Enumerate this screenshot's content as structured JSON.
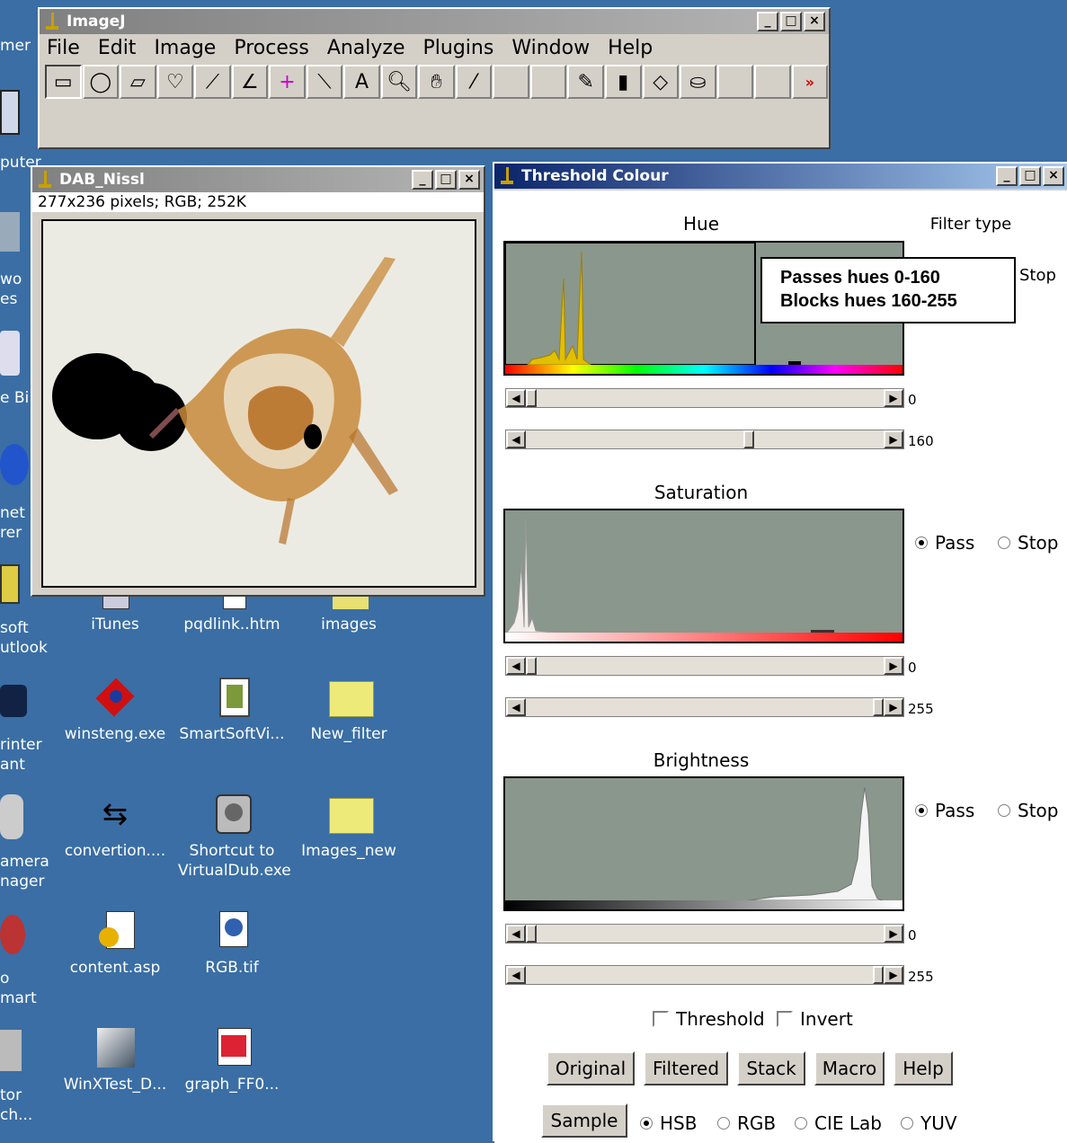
{
  "imagej": {
    "title": "ImageJ",
    "menus": [
      "File",
      "Edit",
      "Image",
      "Process",
      "Analyze",
      "Plugins",
      "Window",
      "Help"
    ],
    "tools": [
      "rectangle-tool-icon",
      "oval-tool-icon",
      "polygon-tool-icon",
      "freehand-tool-icon",
      "line-tool-icon",
      "angle-tool-icon",
      "point-tool-icon",
      "wand-tool-icon",
      "text-tool-icon",
      "magnifier-tool-icon",
      "hand-tool-icon",
      "dropper-tool-icon",
      "pencil-tool-icon",
      "brush-tool-icon",
      "eraser-tool-icon",
      "flood-fill-tool-icon",
      "more-tools-icon"
    ],
    "more_label": "»"
  },
  "image_window": {
    "title": "DAB_Nissl",
    "info": "277x236 pixels; RGB; 252K"
  },
  "threshold": {
    "title": "Threshold Colour",
    "filter_type_label": "Filter type",
    "hue_label": "Hue",
    "saturation_label": "Saturation",
    "brightness_label": "Brightness",
    "callout_line1": "Passes hues 0-160",
    "callout_line2": "Blocks hues 160-255",
    "hue_stop_partial": "Stop",
    "hue_min": "0",
    "hue_max": "160",
    "sat_min": "0",
    "sat_max": "255",
    "bri_min": "0",
    "bri_max": "255",
    "hue_min_frac": 0.0,
    "hue_max_frac": 0.627,
    "sat_min_frac": 0.0,
    "sat_max_frac": 1.0,
    "bri_min_frac": 0.0,
    "bri_max_frac": 1.0,
    "pass_label": "Pass",
    "stop_label": "Stop",
    "threshold_label": "Threshold",
    "invert_label": "Invert",
    "buttons": [
      "Original",
      "Filtered",
      "Stack",
      "Macro",
      "Help"
    ],
    "sample_label": "Sample",
    "color_spaces": [
      "HSB",
      "RGB",
      "CIE Lab",
      "YUV"
    ],
    "selected_space": "HSB"
  },
  "desktop": {
    "icons": [
      {
        "label": "iTunes",
        "icon": "itunes-icon"
      },
      {
        "label": "pqdlink..htm",
        "icon": "html-file-icon"
      },
      {
        "label": "images",
        "icon": "folder-icon"
      },
      {
        "label": "winsteng.exe",
        "icon": "exe-icon"
      },
      {
        "label": "SmartSoftVi...",
        "icon": "video-shortcut-icon"
      },
      {
        "label": "New_filter",
        "icon": "folder-icon"
      },
      {
        "label": "convertion....",
        "icon": "convert-icon"
      },
      {
        "label": "Shortcut to",
        "label2": "VirtualDub.exe",
        "icon": "virtualdub-icon"
      },
      {
        "label": "Images_new",
        "icon": "folder-icon"
      },
      {
        "label": "content.asp",
        "icon": "asp-file-icon"
      },
      {
        "label": "RGB.tif",
        "icon": "tif-file-icon"
      },
      {
        "label": "WinXTest_D...",
        "icon": "image-file-icon"
      },
      {
        "label": "graph_FF0...",
        "icon": "graph-file-icon"
      }
    ],
    "left_labels": [
      "mer",
      "puter",
      "wo",
      "es",
      "e Bi",
      "net",
      "rer",
      "soft",
      "utlook",
      "rinter",
      "ant",
      "amera",
      "nager",
      "o",
      "mart",
      "tor",
      "ch..."
    ]
  }
}
